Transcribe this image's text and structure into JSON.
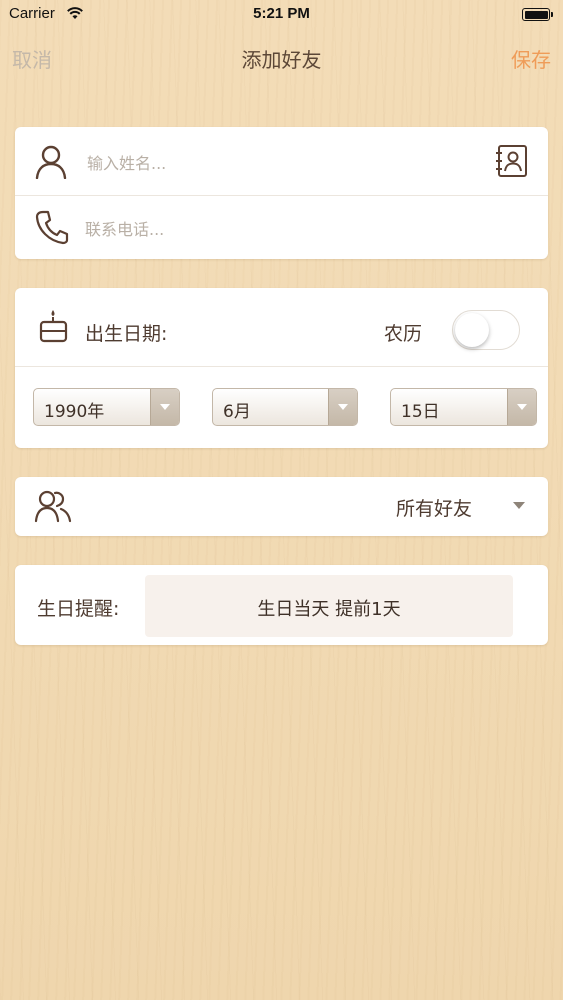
{
  "status_bar": {
    "carrier": "Carrier",
    "time": "5:21 PM"
  },
  "nav": {
    "cancel": "取消",
    "title": "添加好友",
    "save": "保存"
  },
  "contact": {
    "name_placeholder": "输入姓名...",
    "phone_placeholder": "联系电话..."
  },
  "birthday": {
    "label": "出生日期:",
    "lunar_label": "农历",
    "lunar_on": false,
    "year": "1990年",
    "month": "6月",
    "day": "15日"
  },
  "group": {
    "selected": "所有好友"
  },
  "reminder": {
    "label": "生日提醒:",
    "value": "生日当天 提前1天"
  },
  "colors": {
    "accent": "#ef9c58",
    "disabled": "#c4b8a9",
    "icon": "#5b4032"
  },
  "icons": [
    "wifi-icon",
    "battery-icon",
    "person-icon",
    "contacts-book-icon",
    "phone-icon",
    "cake-icon",
    "group-icon",
    "dropdown-arrow-icon"
  ]
}
